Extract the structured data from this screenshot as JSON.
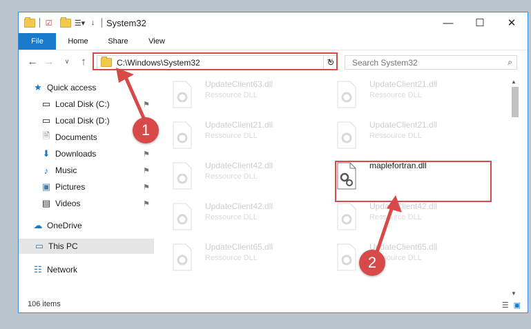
{
  "window": {
    "title": "System32",
    "caption_buttons": {
      "minimize": "—",
      "maximize": "☐",
      "close": "✕"
    }
  },
  "ribbon": {
    "tabs": [
      "File",
      "Home",
      "Share",
      "View"
    ]
  },
  "address": {
    "path": "C:\\Windows\\System32",
    "search_placeholder": "Search System32"
  },
  "nav": {
    "quick_access": "Quick access",
    "items": [
      {
        "label": "Local Disk (C:)",
        "icon": "drive-icon",
        "pinned": true
      },
      {
        "label": "Local Disk (D:)",
        "icon": "drive-icon",
        "pinned": false
      },
      {
        "label": "Documents",
        "icon": "documents-icon",
        "pinned": true
      },
      {
        "label": "Downloads",
        "icon": "downloads-icon",
        "pinned": true
      },
      {
        "label": "Music",
        "icon": "music-icon",
        "pinned": true
      },
      {
        "label": "Pictures",
        "icon": "pictures-icon",
        "pinned": true
      },
      {
        "label": "Videos",
        "icon": "videos-icon",
        "pinned": true
      }
    ],
    "onedrive": "OneDrive",
    "this_pc": "This PC",
    "network": "Network"
  },
  "files": [
    {
      "name": "UpdateClient63.dll",
      "type": "Ressource DLL"
    },
    {
      "name": "UpdateClient21.dll",
      "type": "Ressource DLL"
    },
    {
      "name": "UpdateClient21.dll",
      "type": "Ressource DLL"
    },
    {
      "name": "UpdateClient21.dll",
      "type": "Ressource DLL"
    },
    {
      "name": "UpdateClient42.dll",
      "type": "Ressource DLL"
    },
    {
      "name": "maplefortran.dll",
      "type": ""
    },
    {
      "name": "UpdateClient42.dll",
      "type": "Ressource DLL"
    },
    {
      "name": "UpdateClient42.dll",
      "type": "Ressource DLL"
    },
    {
      "name": "UpdateClient65.dll",
      "type": "Ressource DLL"
    },
    {
      "name": "UpdateClient65.dll",
      "type": "Ressource DLL"
    }
  ],
  "status": {
    "count": "106 items"
  },
  "annotations": {
    "step1": "1",
    "step2": "2",
    "color": "#d84a4a"
  }
}
